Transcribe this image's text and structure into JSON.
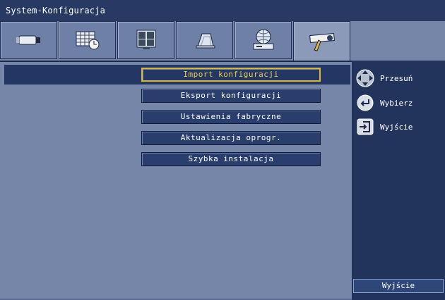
{
  "window": {
    "title": "System-Konfiguracja"
  },
  "tabs": [
    {
      "icon": "camera-icon",
      "active": false
    },
    {
      "icon": "schedule-icon",
      "active": false
    },
    {
      "icon": "monitor-icon",
      "active": false
    },
    {
      "icon": "recording-icon",
      "active": false
    },
    {
      "icon": "network-icon",
      "active": false
    },
    {
      "icon": "tools-icon",
      "active": true
    }
  ],
  "menu": {
    "items": [
      {
        "label": "Import konfiguracji",
        "selected": true
      },
      {
        "label": "Eksport konfiguracji",
        "selected": false
      },
      {
        "label": "Ustawienia fabryczne",
        "selected": false
      },
      {
        "label": "Aktualizacja oprogr.",
        "selected": false
      },
      {
        "label": "Szybka instalacja",
        "selected": false
      }
    ]
  },
  "hints": {
    "move": {
      "icon": "dpad-icon",
      "label": "Przesuń"
    },
    "select": {
      "icon": "enter-icon",
      "label": "Wybierz"
    },
    "exit": {
      "icon": "exit-icon",
      "label": "Wyjście"
    }
  },
  "footer": {
    "exit_button": "Wyjście"
  },
  "colors": {
    "accent": "#d8b832",
    "panel": "#22345c",
    "background": "#7686a8"
  }
}
